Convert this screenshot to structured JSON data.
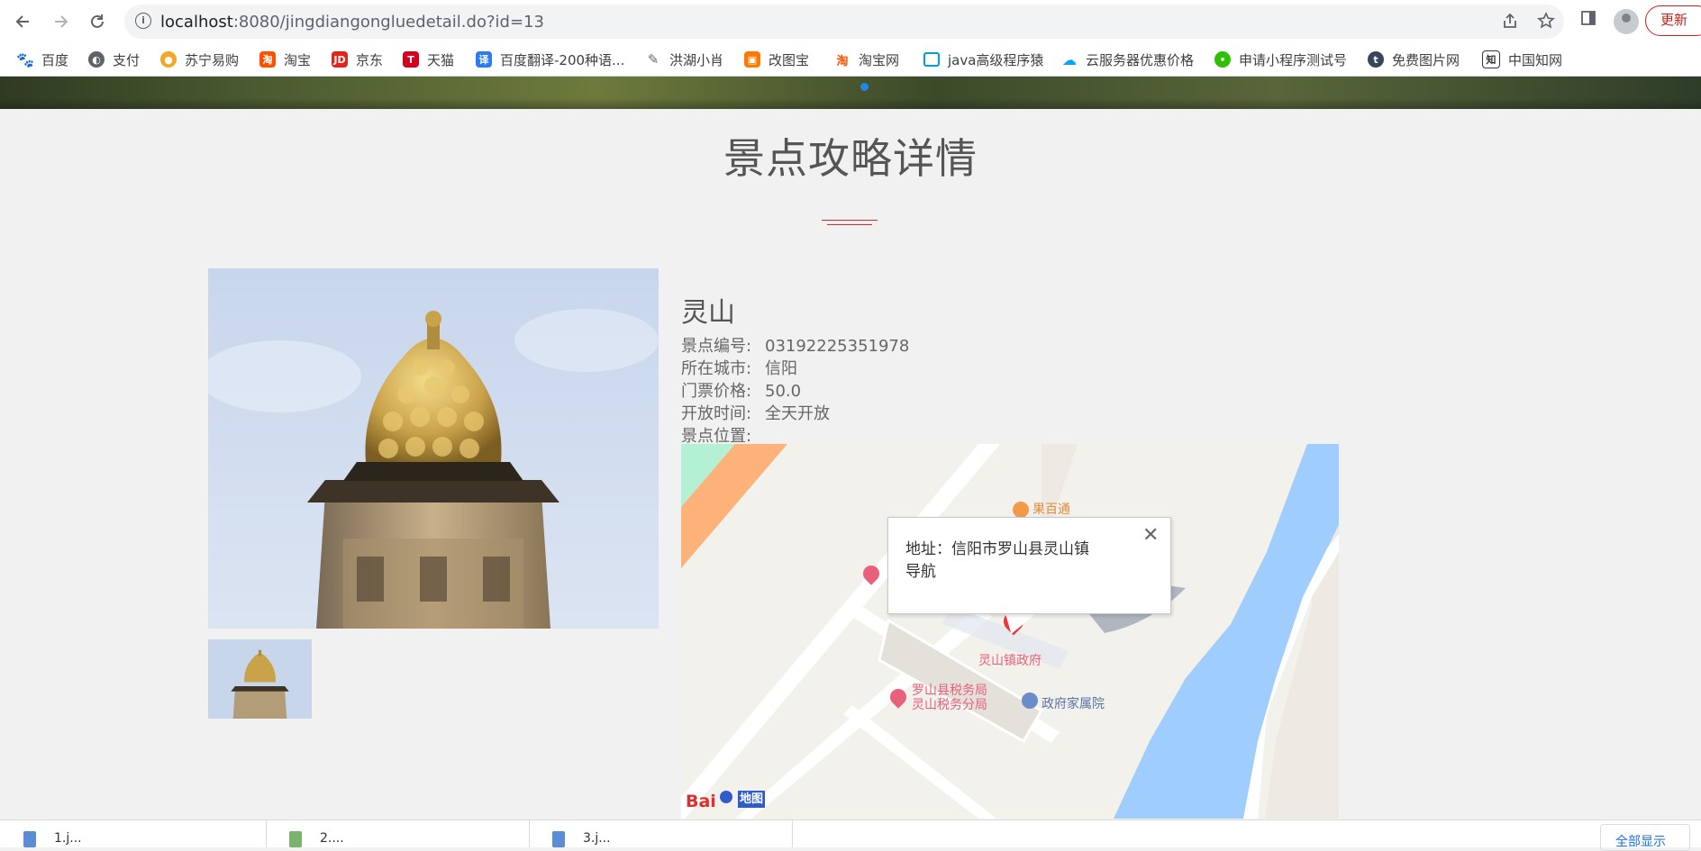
{
  "browser": {
    "url_host": "localhost",
    "url_rest": ":8080/jingdiangongluedetail.do?id=13",
    "update_label": "更新",
    "bookmarks": [
      {
        "label": "百度",
        "icon": "baidu-paw-icon",
        "color": "#2932e1"
      },
      {
        "label": "支付",
        "icon": "globe-icon",
        "color": "#5f6368"
      },
      {
        "label": "苏宁易购",
        "icon": "suning-lion-icon",
        "color": "#f5a623"
      },
      {
        "label": "淘宝",
        "icon": "taobao-icon",
        "color": "#ff5000"
      },
      {
        "label": "京东",
        "icon": "jd-icon",
        "color": "#e1251b"
      },
      {
        "label": "天猫",
        "icon": "tmall-icon",
        "color": "#d6001c"
      },
      {
        "label": "百度翻译-200种语...",
        "icon": "translate-icon",
        "color": "#2b7bf3"
      },
      {
        "label": "洪湖小肖",
        "icon": "bird-icon",
        "color": "#666666"
      },
      {
        "label": "改图宝",
        "icon": "gaitubao-icon",
        "color": "#ff7a00"
      },
      {
        "label": "淘宝网",
        "icon": "taobao-icon",
        "color": "#ff5000"
      },
      {
        "label": "java高级程序猿",
        "icon": "tv-icon",
        "color": "#00a1d6"
      },
      {
        "label": "云服务器优惠价格",
        "icon": "cloud-icon",
        "color": "#00a3ff"
      },
      {
        "label": "申请小程序测试号",
        "icon": "wechat-icon",
        "color": "#2dc100"
      },
      {
        "label": "免费图片网",
        "icon": "t-icon",
        "color": "#35465c"
      },
      {
        "label": "中国知网",
        "icon": "cnki-icon",
        "color": "#333333"
      }
    ]
  },
  "page": {
    "title": "景点攻略详情",
    "spot": {
      "name": "灵山",
      "fields": [
        {
          "label": "景点编号:",
          "value": "03192225351978"
        },
        {
          "label": "所在城市:",
          "value": "信阳"
        },
        {
          "label": "门票价格:",
          "value": "50.0"
        },
        {
          "label": "开放时间:",
          "value": "全天开放"
        },
        {
          "label": "景点位置:",
          "value": ""
        }
      ]
    },
    "map": {
      "popup_address": "地址：信阳市罗山县灵山镇",
      "popup_nav": "导航",
      "close_glyph": "✕",
      "poi": {
        "shop": "果百通",
        "gov": "灵山镇政府",
        "tax_line1": "罗山县税务局",
        "tax_line2": "灵山税务分局",
        "housing": "政府家属院"
      },
      "logo_text": "地图"
    }
  },
  "downloads": {
    "items": [
      "1.j...",
      "2....",
      "3.j..."
    ],
    "show_all": "全部显示"
  }
}
